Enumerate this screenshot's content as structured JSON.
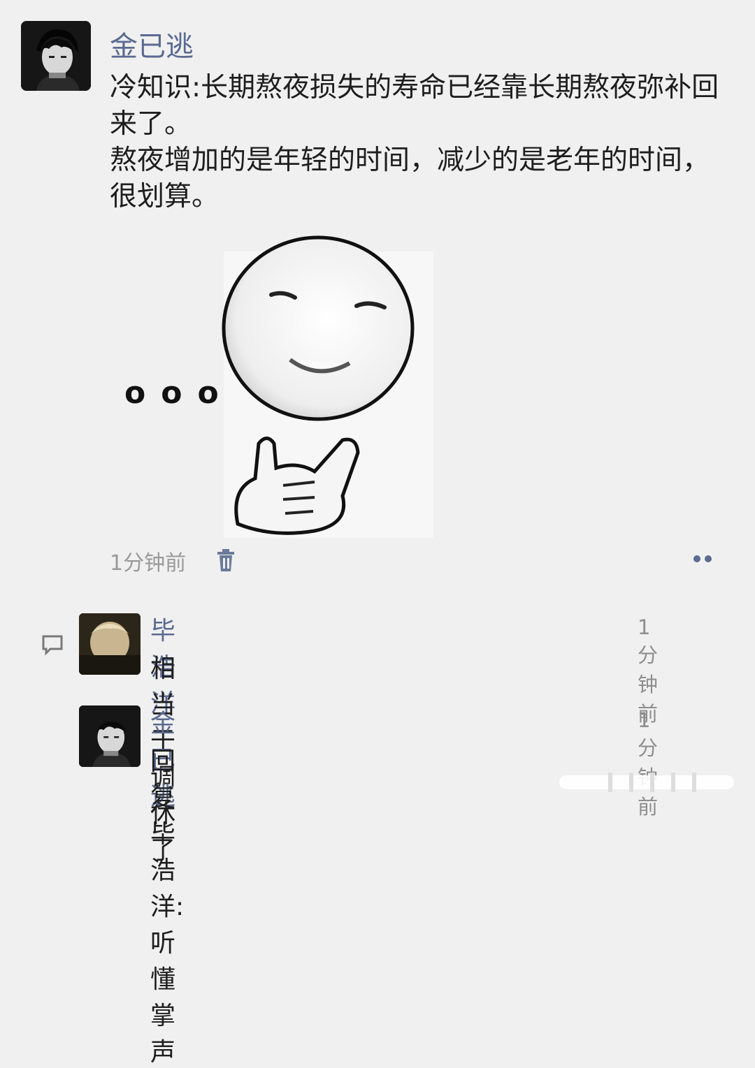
{
  "post": {
    "author": "金已逃",
    "lines": [
      "冷知识:长期熬夜损失的寿命已经靠长期熬夜弥补回来了。",
      "熬夜增加的是年轻的时间，减少的是老年的时间，很划算。"
    ],
    "time": "1分钟前",
    "sticker_dots": "ooo"
  },
  "comments": [
    {
      "author": "毕浩洋",
      "text": "相当于调休了",
      "time": "1分钟前"
    },
    {
      "author": "金已逃",
      "text": "回复毕浩洋: 听懂掌声",
      "time": "1分钟前"
    }
  ],
  "icons": {
    "trash": "trash-icon",
    "more": "more-dots-icon",
    "comment": "comment-bubble-icon"
  },
  "colors": {
    "name": "#5a6a90",
    "background": "#f0f0f0",
    "text": "#1e1e1e",
    "meta": "#9a9a9a"
  }
}
